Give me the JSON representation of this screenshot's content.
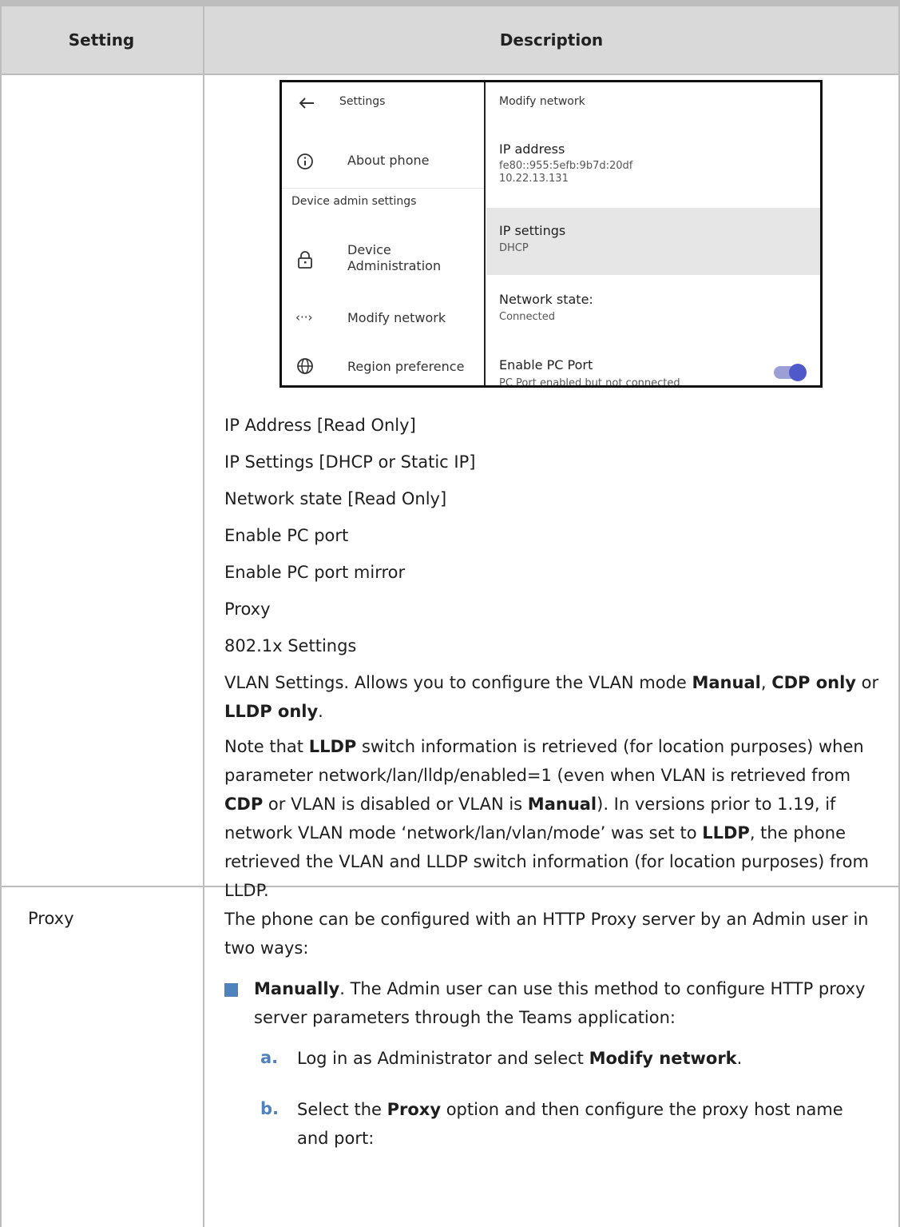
{
  "header": {
    "setting": "Setting",
    "description": "Description"
  },
  "screenshot": {
    "left_title": "Settings",
    "about_phone": "About phone",
    "section_label": "Device admin settings",
    "device_admin_line1": "Device",
    "device_admin_line2": "Administration",
    "modify_network": "Modify network",
    "region_preference": "Region preference",
    "right_title": "Modify network",
    "ip_address_label": "IP address",
    "ip_address_v6": "fe80::955:5efb:9b7d:20df",
    "ip_address_v4": "10.22.13.131",
    "ip_settings_label": "IP settings",
    "ip_settings_value": "DHCP",
    "network_state_label": "Network state:",
    "network_state_value": "Connected",
    "enable_pc_port_label": "Enable PC Port",
    "enable_pc_port_value": "PC Port enabled but not connected",
    "toggle_on": true
  },
  "items": [
    "IP Address [Read Only]",
    "IP Settings [DHCP or Static IP]",
    "Network state [Read Only]",
    "Enable PC port",
    "Enable PC port mirror",
    "Proxy",
    "802.1x Settings"
  ],
  "vlan": {
    "prefix": "VLAN Settings. Allows you to configure the VLAN mode ",
    "manual": "Manual",
    "sep1": ", ",
    "cdp_only": "CDP only",
    "sep2": " or ",
    "lldp_only": "LLDP only",
    "suffix": "."
  },
  "note": {
    "t1": "Note that ",
    "b1": "LLDP",
    "t2": " switch information is retrieved (for location purposes) when parameter network/lan/lldp/enabled=1 (even when VLAN is retrieved from ",
    "b2": "CDP",
    "t3": " or VLAN is disabled or VLAN is ",
    "b3": "Manual",
    "t4": "). In versions prior to 1.19, if network VLAN mode ‘network/lan/vlan/mode’ was set to ",
    "b4": "LLDP",
    "t5": ", the phone retrieved the VLAN and LLDP switch information (for location purposes) from LLDP."
  },
  "proxy_row": {
    "setting": "Proxy",
    "intro": "The phone can be configured with an HTTP Proxy server by an Admin user in two ways:",
    "bullet_bold": "Manually",
    "bullet_text": ". The Admin user can use this method to configure HTTP proxy server parameters through the Teams application:",
    "step_a_letter": "a.",
    "step_a_text": "Log in as Administrator and select ",
    "step_a_bold": "Modify network",
    "step_a_end": ".",
    "step_b_letter": "b.",
    "step_b_text1": "Select the ",
    "step_b_bold": "Proxy",
    "step_b_text2": " option and then configure the proxy host name and port:"
  },
  "colors": {
    "header_bg": "#d9d9d9",
    "border": "#bdbdbd",
    "accent": "#4f81bd",
    "toggle": "#5059c9",
    "highlight": "#e6e6e6"
  }
}
